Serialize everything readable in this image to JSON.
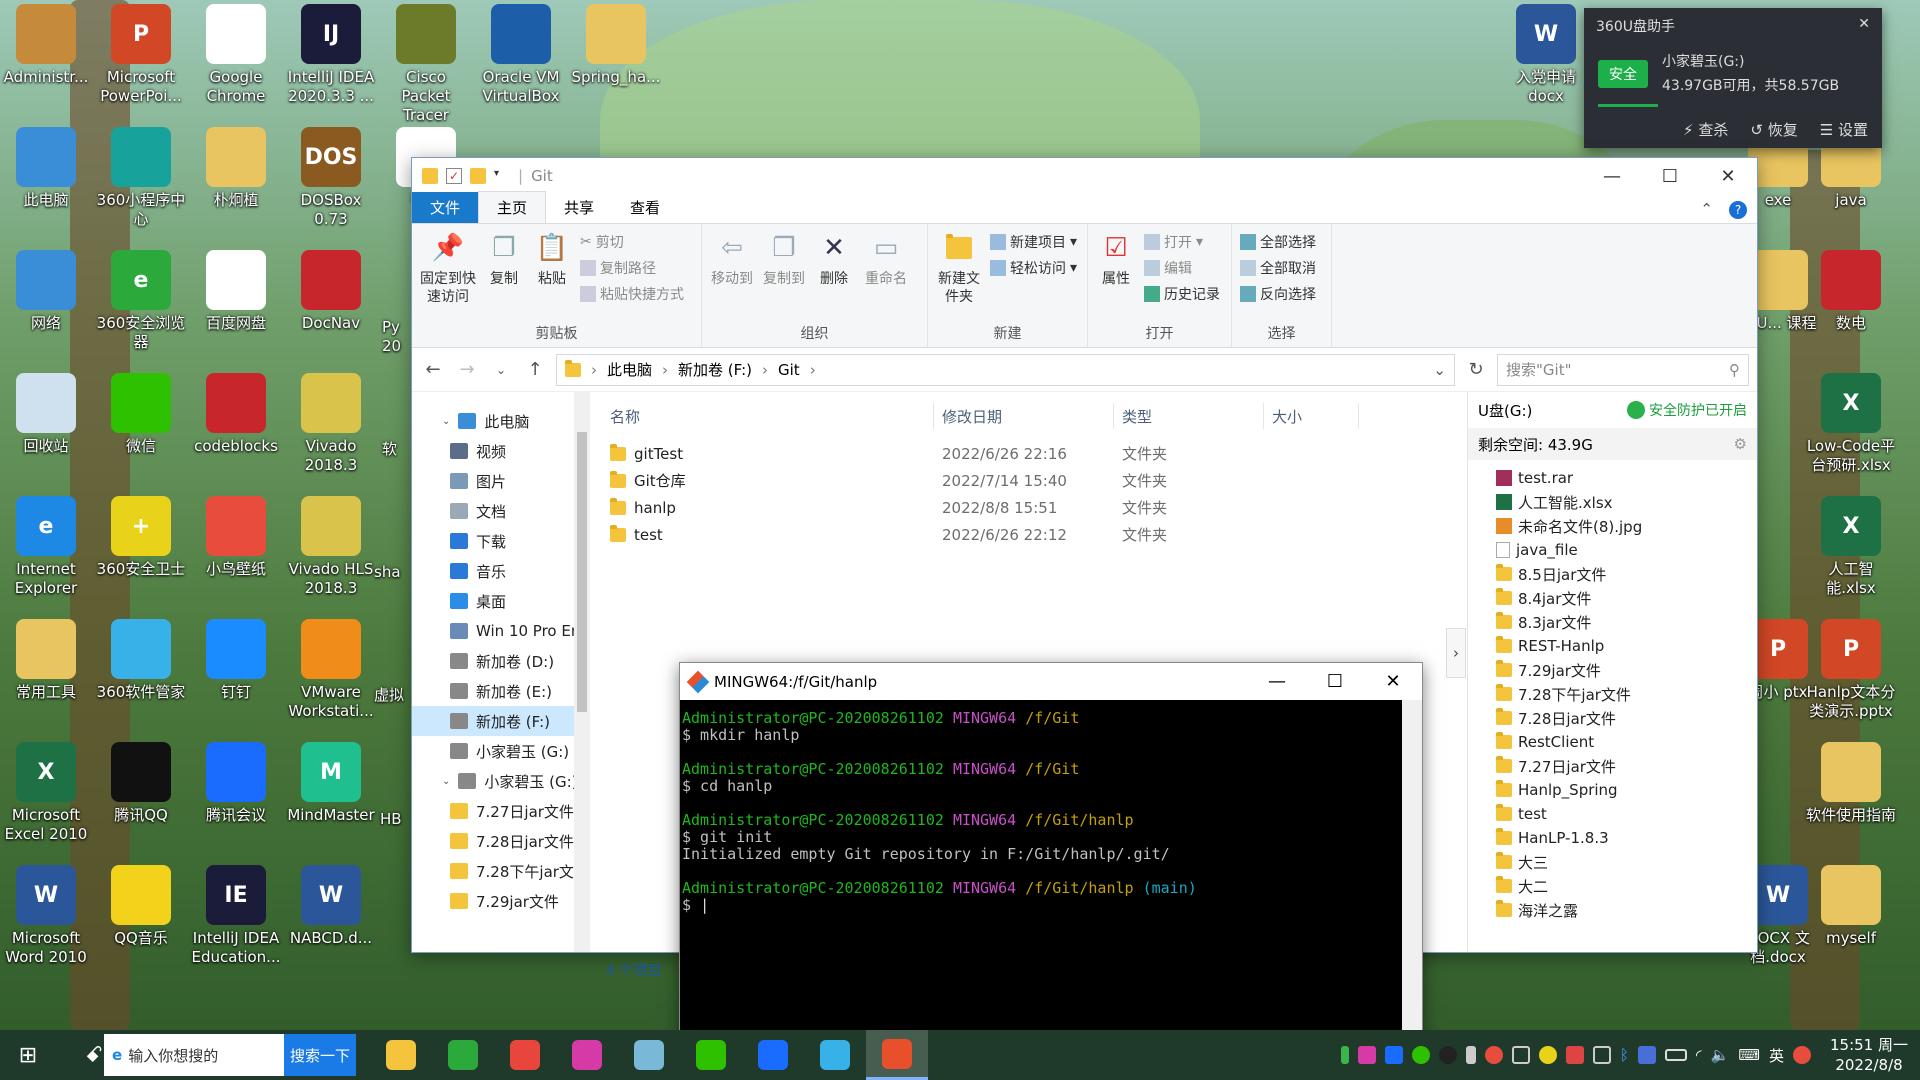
{
  "desktop": {
    "icons": [
      {
        "label": "Administr...",
        "color": "#c58b3a",
        "glyph": "",
        "col": 0,
        "row": 0
      },
      {
        "label": "Microsoft PowerPoi...",
        "color": "#d24726",
        "glyph": "P",
        "col": 1,
        "row": 0
      },
      {
        "label": "Google Chrome",
        "color": "#ffffff",
        "glyph": "",
        "col": 2,
        "row": 0
      },
      {
        "label": "IntelliJ IDEA 2020.3.3 ...",
        "color": "#1b1b3a",
        "glyph": "IJ",
        "col": 3,
        "row": 0
      },
      {
        "label": "Cisco Packet Tracer",
        "color": "#6b7b2a",
        "glyph": "",
        "col": 4,
        "row": 0
      },
      {
        "label": "Oracle VM VirtualBox",
        "color": "#1c5fa8",
        "glyph": "",
        "col": 5,
        "row": 0
      },
      {
        "label": "Spring_ha...",
        "color": "#e8c560",
        "glyph": "",
        "col": 6,
        "row": 0
      },
      {
        "label": "此电脑",
        "color": "#3a8ed8",
        "glyph": "",
        "col": 0,
        "row": 1
      },
      {
        "label": "360小程序中心",
        "color": "#17a39b",
        "glyph": "",
        "col": 1,
        "row": 1
      },
      {
        "label": "朴炯植",
        "color": "#e8c560",
        "glyph": "",
        "col": 2,
        "row": 1
      },
      {
        "label": "DOSBox 0.73",
        "color": "#8a5a20",
        "glyph": "DOS",
        "col": 3,
        "row": 1
      },
      {
        "label": "微信",
        "color": "#ffffff",
        "glyph": "",
        "col": 4,
        "row": 1
      },
      {
        "label": "网络",
        "color": "#3a8ed8",
        "glyph": "",
        "col": 0,
        "row": 2
      },
      {
        "label": "360安全浏览器",
        "color": "#2ba93b",
        "glyph": "e",
        "col": 1,
        "row": 2
      },
      {
        "label": "百度网盘",
        "color": "#ffffff",
        "glyph": "",
        "col": 2,
        "row": 2
      },
      {
        "label": "DocNav",
        "color": "#c8262d",
        "glyph": "",
        "col": 3,
        "row": 2
      },
      {
        "label": "回收站",
        "color": "#cfe0ee",
        "glyph": "",
        "col": 0,
        "row": 3
      },
      {
        "label": "微信",
        "color": "#2dc100",
        "glyph": "",
        "col": 1,
        "row": 3
      },
      {
        "label": "codeblocks",
        "color": "#c8262d",
        "glyph": "",
        "col": 2,
        "row": 3
      },
      {
        "label": "Vivado 2018.3",
        "color": "#d9c34a",
        "glyph": "",
        "col": 3,
        "row": 3
      },
      {
        "label": "Internet Explorer",
        "color": "#1e88e5",
        "glyph": "e",
        "col": 0,
        "row": 4
      },
      {
        "label": "360安全卫士",
        "color": "#e8d21a",
        "glyph": "+",
        "col": 1,
        "row": 4
      },
      {
        "label": "小鸟壁纸",
        "color": "#e84c3d",
        "glyph": "",
        "col": 2,
        "row": 4
      },
      {
        "label": "Vivado HLS 2018.3",
        "color": "#d9c34a",
        "glyph": "",
        "col": 3,
        "row": 4
      },
      {
        "label": "常用工具",
        "color": "#e8c560",
        "glyph": "",
        "col": 0,
        "row": 5
      },
      {
        "label": "360软件管家",
        "color": "#38b0e8",
        "glyph": "",
        "col": 1,
        "row": 5
      },
      {
        "label": "钉钉",
        "color": "#1a8cff",
        "glyph": "",
        "col": 2,
        "row": 5
      },
      {
        "label": "VMware Workstati...",
        "color": "#f08c1a",
        "glyph": "",
        "col": 3,
        "row": 5
      },
      {
        "label": "Microsoft Excel 2010",
        "color": "#1e7145",
        "glyph": "X",
        "col": 0,
        "row": 6
      },
      {
        "label": "腾讯QQ",
        "color": "#111111",
        "glyph": "",
        "col": 1,
        "row": 6
      },
      {
        "label": "腾讯会议",
        "color": "#1a6cff",
        "glyph": "",
        "col": 2,
        "row": 6
      },
      {
        "label": "MindMaster",
        "color": "#1fbf8f",
        "glyph": "M",
        "col": 3,
        "row": 6
      },
      {
        "label": "Microsoft Word 2010",
        "color": "#2b579a",
        "glyph": "W",
        "col": 0,
        "row": 7
      },
      {
        "label": "QQ音乐",
        "color": "#f2d21a",
        "glyph": "",
        "col": 1,
        "row": 7
      },
      {
        "label": "IntelliJ IDEA Education...",
        "color": "#1b1b3a",
        "glyph": "IE",
        "col": 2,
        "row": 7
      },
      {
        "label": "NABCD.d...",
        "color": "#2b579a",
        "glyph": "W",
        "col": 3,
        "row": 7
      }
    ],
    "partial_labels_middle": [
      "Py 20",
      "软",
      "sha",
      "虚拟",
      "HB"
    ],
    "right_icons": [
      {
        "label": "入党申请 docx",
        "color": "#2b579a",
        "glyph": "W"
      },
      {
        "label": "exe",
        "color": "#e8c560",
        "glyph": ""
      },
      {
        "label": "java",
        "color": "#e8c560",
        "glyph": ""
      },
      {
        "label": "4_U... 课程",
        "color": "#e8c560",
        "glyph": ""
      },
      {
        "label": "数电",
        "color": "#c8262d",
        "glyph": ""
      },
      {
        "label": "Low-Code平台预研.xlsx",
        "color": "#1e7145",
        "glyph": "X"
      },
      {
        "label": "人工智能.xlsx",
        "color": "#1e7145",
        "glyph": "X"
      },
      {
        "label": "周小 ptx",
        "color": "#d24726",
        "glyph": "P"
      },
      {
        "label": "Hanlp文本分类演示.pptx",
        "color": "#d24726",
        "glyph": "P"
      },
      {
        "label": "软件使用指南",
        "color": "#e8c560",
        "glyph": ""
      },
      {
        "label": "DOCX 文档.docx",
        "color": "#2b579a",
        "glyph": "W"
      },
      {
        "label": "myself",
        "color": "#e8c560",
        "glyph": ""
      }
    ]
  },
  "explorer": {
    "title": "Git",
    "tabs": [
      "文件",
      "主页",
      "共享",
      "查看"
    ],
    "ribbon": {
      "clipboard": {
        "pin": "固定到快速访问",
        "copy": "复制",
        "paste": "粘贴",
        "cut": "剪切",
        "copy_path": "复制路径",
        "paste_shortcut": "粘贴快捷方式",
        "label": "剪贴板"
      },
      "organize": {
        "move_to": "移动到",
        "copy_to": "复制到",
        "delete": "删除",
        "rename": "重命名",
        "label": "组织"
      },
      "new": {
        "new_folder": "新建文件夹",
        "new_item": "新建项目",
        "easy_access": "轻松访问",
        "label": "新建"
      },
      "open": {
        "properties": "属性",
        "open": "打开",
        "edit": "编辑",
        "history": "历史记录",
        "label": "打开"
      },
      "select": {
        "select_all": "全部选择",
        "select_none": "全部取消",
        "invert": "反向选择",
        "label": "选择"
      }
    },
    "breadcrumb": [
      "此电脑",
      "新加卷 (F:)",
      "Git"
    ],
    "search_placeholder": "搜索\"Git\"",
    "nav": [
      {
        "label": "此电脑",
        "color": "#3a8ed8",
        "top": true
      },
      {
        "label": "视频",
        "color": "#5a6e88"
      },
      {
        "label": "图片",
        "color": "#7a9ab8"
      },
      {
        "label": "文档",
        "color": "#9aa8b8"
      },
      {
        "label": "下载",
        "color": "#2a78d8"
      },
      {
        "label": "音乐",
        "color": "#2a78d8"
      },
      {
        "label": "桌面",
        "color": "#2a8ee8"
      },
      {
        "label": "Win 10 Pro Ent",
        "color": "#6a8ab8"
      },
      {
        "label": "新加卷 (D:)",
        "color": "#888888"
      },
      {
        "label": "新加卷 (E:)",
        "color": "#888888"
      },
      {
        "label": "新加卷 (F:)",
        "color": "#888888",
        "selected": true
      },
      {
        "label": "小家碧玉 (G:)",
        "color": "#888888"
      },
      {
        "label": "小家碧玉 (G:)",
        "color": "#888888",
        "top": true
      },
      {
        "label": "7.27日jar文件",
        "color": "#f4c43d"
      },
      {
        "label": "7.28日jar文件",
        "color": "#f4c43d"
      },
      {
        "label": "7.28下午jar文件",
        "color": "#f4c43d"
      },
      {
        "label": "7.29jar文件",
        "color": "#f4c43d"
      }
    ],
    "columns": [
      "名称",
      "修改日期",
      "类型",
      "大小"
    ],
    "files": [
      {
        "name": "gitTest",
        "date": "2022/6/26 22:16",
        "type": "文件夹",
        "size": ""
      },
      {
        "name": "Git仓库",
        "date": "2022/7/14 15:40",
        "type": "文件夹",
        "size": ""
      },
      {
        "name": "hanlp",
        "date": "2022/8/8 15:51",
        "type": "文件夹",
        "size": ""
      },
      {
        "name": "test",
        "date": "2022/6/26 22:12",
        "type": "文件夹",
        "size": ""
      }
    ],
    "status": "4 个项目",
    "usb": {
      "title": "U盘(G:)",
      "safe": "安全防护已开启",
      "space": "剩余空间: 43.9G",
      "items": [
        {
          "name": "test.rar",
          "kind": "rar"
        },
        {
          "name": "人工智能.xlsx",
          "kind": "xlsx"
        },
        {
          "name": "未命名文件(8).jpg",
          "kind": "jpg"
        },
        {
          "name": "java_file",
          "kind": "file"
        },
        {
          "name": "8.5日jar文件",
          "kind": "folder"
        },
        {
          "name": "8.4jar文件",
          "kind": "folder"
        },
        {
          "name": "8.3jar文件",
          "kind": "folder"
        },
        {
          "name": "REST-Hanlp",
          "kind": "folder"
        },
        {
          "name": "7.29jar文件",
          "kind": "folder"
        },
        {
          "name": "7.28下午jar文件",
          "kind": "folder"
        },
        {
          "name": "7.28日jar文件",
          "kind": "folder"
        },
        {
          "name": "RestClient",
          "kind": "folder"
        },
        {
          "name": "7.27日jar文件",
          "kind": "folder"
        },
        {
          "name": "Hanlp_Spring",
          "kind": "folder"
        },
        {
          "name": "test",
          "kind": "folder"
        },
        {
          "name": "HanLP-1.8.3",
          "kind": "folder"
        },
        {
          "name": "大三",
          "kind": "folder"
        },
        {
          "name": "大二",
          "kind": "folder"
        },
        {
          "name": "海洋之露",
          "kind": "folder"
        }
      ]
    }
  },
  "terminal": {
    "title": "MINGW64:/f/Git/hanlp",
    "user": "Administrator@PC-202008261102",
    "env": "MINGW64",
    "blocks": [
      {
        "path": "/f/Git",
        "branch": "",
        "cmd": "$ mkdir hanlp",
        "output": ""
      },
      {
        "path": "/f/Git",
        "branch": "",
        "cmd": "$ cd hanlp",
        "output": ""
      },
      {
        "path": "/f/Git/hanlp",
        "branch": "",
        "cmd": "$ git init",
        "output": "Initialized empty Git repository in F:/Git/hanlp/.git/"
      },
      {
        "path": "/f/Git/hanlp",
        "branch": "(main)",
        "cmd": "$ ",
        "output": ""
      }
    ]
  },
  "popup360": {
    "title": "360U盘助手",
    "safe": "安全",
    "drive": "小家碧玉(G:)",
    "space": "43.97GB可用，共58.57GB",
    "actions": [
      "查杀",
      "恢复",
      "设置"
    ]
  },
  "taskbar": {
    "search_placeholder": "输入你想搜的",
    "search_button": "搜索一下",
    "apps": [
      {
        "name": "file-explorer",
        "color": "#f4c43d"
      },
      {
        "name": "360-browser",
        "color": "#2ba93b"
      },
      {
        "name": "chrome",
        "color": "#e8453c"
      },
      {
        "name": "intellij",
        "color": "#d63aa6"
      },
      {
        "name": "notepad",
        "color": "#7ab8d8"
      },
      {
        "name": "wechat",
        "color": "#2dc100"
      },
      {
        "name": "tencent-meeting",
        "color": "#1a6cff"
      },
      {
        "name": "360-software",
        "color": "#38b0e8"
      },
      {
        "name": "git-bash",
        "color": "#e8502c",
        "active": true
      }
    ],
    "ime": "英",
    "time": "15:51 周一",
    "date": "2022/8/8"
  }
}
